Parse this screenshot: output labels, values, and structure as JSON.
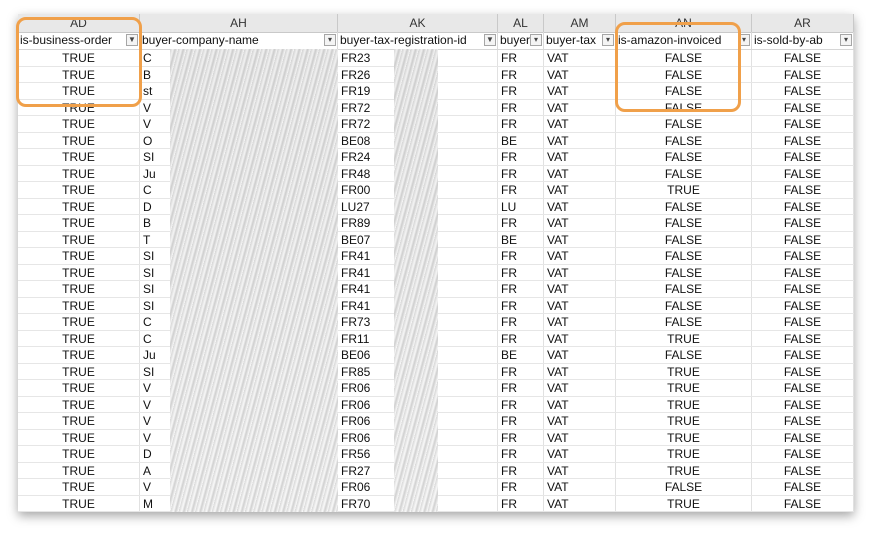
{
  "columns": [
    {
      "letter": "AD",
      "header": "is-business-order",
      "filter": "funnel"
    },
    {
      "letter": "AH",
      "header": "buyer-company-name",
      "filter": "arrow"
    },
    {
      "letter": "AK",
      "header": "buyer-tax-registration-id",
      "filter": "funnel"
    },
    {
      "letter": "AL",
      "header": "buyer",
      "filter": "arrow"
    },
    {
      "letter": "AM",
      "header": "buyer-tax",
      "filter": "arrow"
    },
    {
      "letter": "AN",
      "header": "is-amazon-invoiced",
      "filter": "arrow"
    },
    {
      "letter": "AR",
      "header": "is-sold-by-ab",
      "filter": "arrow"
    }
  ],
  "rows": [
    {
      "ad": "TRUE",
      "ah": "C",
      "ak": "FR23",
      "al": "FR",
      "am": "VAT",
      "an": "FALSE",
      "ar": "FALSE"
    },
    {
      "ad": "TRUE",
      "ah": "B",
      "ak": "FR26",
      "al": "FR",
      "am": "VAT",
      "an": "FALSE",
      "ar": "FALSE"
    },
    {
      "ad": "TRUE",
      "ah": "st",
      "ak": "FR19",
      "al": "FR",
      "am": "VAT",
      "an": "FALSE",
      "ar": "FALSE"
    },
    {
      "ad": "TRUE",
      "ah": "V",
      "ak": "FR72",
      "al": "FR",
      "am": "VAT",
      "an": "FALSE",
      "ar": "FALSE"
    },
    {
      "ad": "TRUE",
      "ah": "V",
      "ak": "FR72",
      "al": "FR",
      "am": "VAT",
      "an": "FALSE",
      "ar": "FALSE"
    },
    {
      "ad": "TRUE",
      "ah": "O",
      "ak": "BE08",
      "al": "BE",
      "am": "VAT",
      "an": "FALSE",
      "ar": "FALSE"
    },
    {
      "ad": "TRUE",
      "ah": "SI",
      "ak": "FR24",
      "al": "FR",
      "am": "VAT",
      "an": "FALSE",
      "ar": "FALSE"
    },
    {
      "ad": "TRUE",
      "ah": "Ju",
      "ak": "FR48",
      "al": "FR",
      "am": "VAT",
      "an": "FALSE",
      "ar": "FALSE"
    },
    {
      "ad": "TRUE",
      "ah": "C",
      "ak": "FR00",
      "al": "FR",
      "am": "VAT",
      "an": "TRUE",
      "ar": "FALSE"
    },
    {
      "ad": "TRUE",
      "ah": "D",
      "ak": "LU27",
      "al": "LU",
      "am": "VAT",
      "an": "FALSE",
      "ar": "FALSE"
    },
    {
      "ad": "TRUE",
      "ah": "B",
      "ak": "FR89",
      "al": "FR",
      "am": "VAT",
      "an": "FALSE",
      "ar": "FALSE"
    },
    {
      "ad": "TRUE",
      "ah": "T",
      "ak": "BE07",
      "al": "BE",
      "am": "VAT",
      "an": "FALSE",
      "ar": "FALSE"
    },
    {
      "ad": "TRUE",
      "ah": "SI",
      "ak": "FR41",
      "al": "FR",
      "am": "VAT",
      "an": "FALSE",
      "ar": "FALSE"
    },
    {
      "ad": "TRUE",
      "ah": "SI",
      "ak": "FR41",
      "al": "FR",
      "am": "VAT",
      "an": "FALSE",
      "ar": "FALSE"
    },
    {
      "ad": "TRUE",
      "ah": "SI",
      "ak": "FR41",
      "al": "FR",
      "am": "VAT",
      "an": "FALSE",
      "ar": "FALSE"
    },
    {
      "ad": "TRUE",
      "ah": "SI",
      "ak": "FR41",
      "al": "FR",
      "am": "VAT",
      "an": "FALSE",
      "ar": "FALSE"
    },
    {
      "ad": "TRUE",
      "ah": "C",
      "ak": "FR73",
      "al": "FR",
      "am": "VAT",
      "an": "FALSE",
      "ar": "FALSE"
    },
    {
      "ad": "TRUE",
      "ah": "C",
      "ak": "FR11",
      "al": "FR",
      "am": "VAT",
      "an": "TRUE",
      "ar": "FALSE"
    },
    {
      "ad": "TRUE",
      "ah": "Ju",
      "ak": "BE06",
      "al": "BE",
      "am": "VAT",
      "an": "FALSE",
      "ar": "FALSE"
    },
    {
      "ad": "TRUE",
      "ah": "SI",
      "ak": "FR85",
      "al": "FR",
      "am": "VAT",
      "an": "TRUE",
      "ar": "FALSE"
    },
    {
      "ad": "TRUE",
      "ah": "V",
      "ak": "FR06",
      "al": "FR",
      "am": "VAT",
      "an": "TRUE",
      "ar": "FALSE"
    },
    {
      "ad": "TRUE",
      "ah": "V",
      "ak": "FR06",
      "al": "FR",
      "am": "VAT",
      "an": "TRUE",
      "ar": "FALSE"
    },
    {
      "ad": "TRUE",
      "ah": "V",
      "ak": "FR06",
      "al": "FR",
      "am": "VAT",
      "an": "TRUE",
      "ar": "FALSE"
    },
    {
      "ad": "TRUE",
      "ah": "V",
      "ak": "FR06",
      "al": "FR",
      "am": "VAT",
      "an": "TRUE",
      "ar": "FALSE"
    },
    {
      "ad": "TRUE",
      "ah": "D",
      "ak": "FR56",
      "al": "FR",
      "am": "VAT",
      "an": "TRUE",
      "ar": "FALSE"
    },
    {
      "ad": "TRUE",
      "ah": "A",
      "ak": "FR27",
      "al": "FR",
      "am": "VAT",
      "an": "TRUE",
      "ar": "FALSE"
    },
    {
      "ad": "TRUE",
      "ah": "V",
      "ak": "FR06",
      "al": "FR",
      "am": "VAT",
      "an": "FALSE",
      "ar": "FALSE"
    },
    {
      "ad": "TRUE",
      "ah": "M",
      "ak": "FR70",
      "al": "FR",
      "am": "VAT",
      "an": "TRUE",
      "ar": "FALSE"
    }
  ],
  "colors": {
    "highlight": "#f0a04a",
    "header_bg": "#e8e8e8"
  }
}
